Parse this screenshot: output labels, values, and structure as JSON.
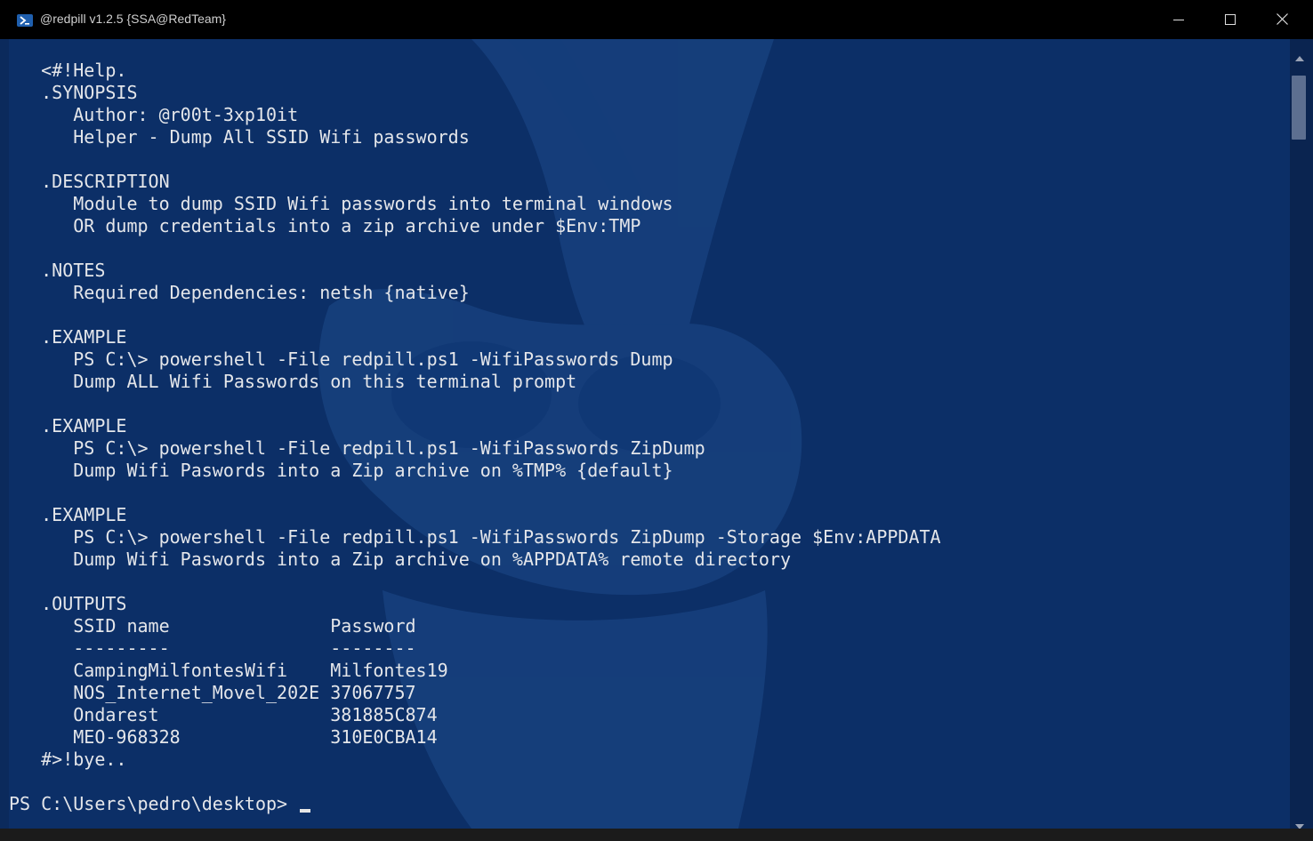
{
  "window": {
    "title": "@redpill v1.2.5 {SSA@RedTeam}",
    "icon": "powershell-icon",
    "controls": [
      "minimize-icon",
      "maximize-icon",
      "close-icon"
    ]
  },
  "terminal": {
    "lines": [
      "   <#!Help.",
      "   .SYNOPSIS",
      "      Author: @r00t-3xp10it",
      "      Helper - Dump All SSID Wifi passwords",
      "",
      "   .DESCRIPTION",
      "      Module to dump SSID Wifi passwords into terminal windows",
      "      OR dump credentials into a zip archive under $Env:TMP",
      "",
      "   .NOTES",
      "      Required Dependencies: netsh {native}",
      "",
      "   .EXAMPLE",
      "      PS C:\\> powershell -File redpill.ps1 -WifiPasswords Dump",
      "      Dump ALL Wifi Passwords on this terminal prompt",
      "",
      "   .EXAMPLE",
      "      PS C:\\> powershell -File redpill.ps1 -WifiPasswords ZipDump",
      "      Dump Wifi Paswords into a Zip archive on %TMP% {default}",
      "",
      "   .EXAMPLE",
      "      PS C:\\> powershell -File redpill.ps1 -WifiPasswords ZipDump -Storage $Env:APPDATA",
      "      Dump Wifi Paswords into a Zip archive on %APPDATA% remote directory",
      "",
      "   .OUTPUTS",
      "      SSID name               Password",
      "      ---------               --------",
      "      CampingMilfontesWifi    Milfontes19",
      "      NOS_Internet_Movel_202E 37067757",
      "      Ondarest                381885C874",
      "      MEO-968328              310E0CBA14",
      "   #>!bye..",
      ""
    ],
    "prompt": "PS C:\\Users\\pedro\\desktop> "
  },
  "colors": {
    "terminal_bg": "#0c2f67",
    "text": "#e4e6ea",
    "titlebar": "#000000"
  }
}
